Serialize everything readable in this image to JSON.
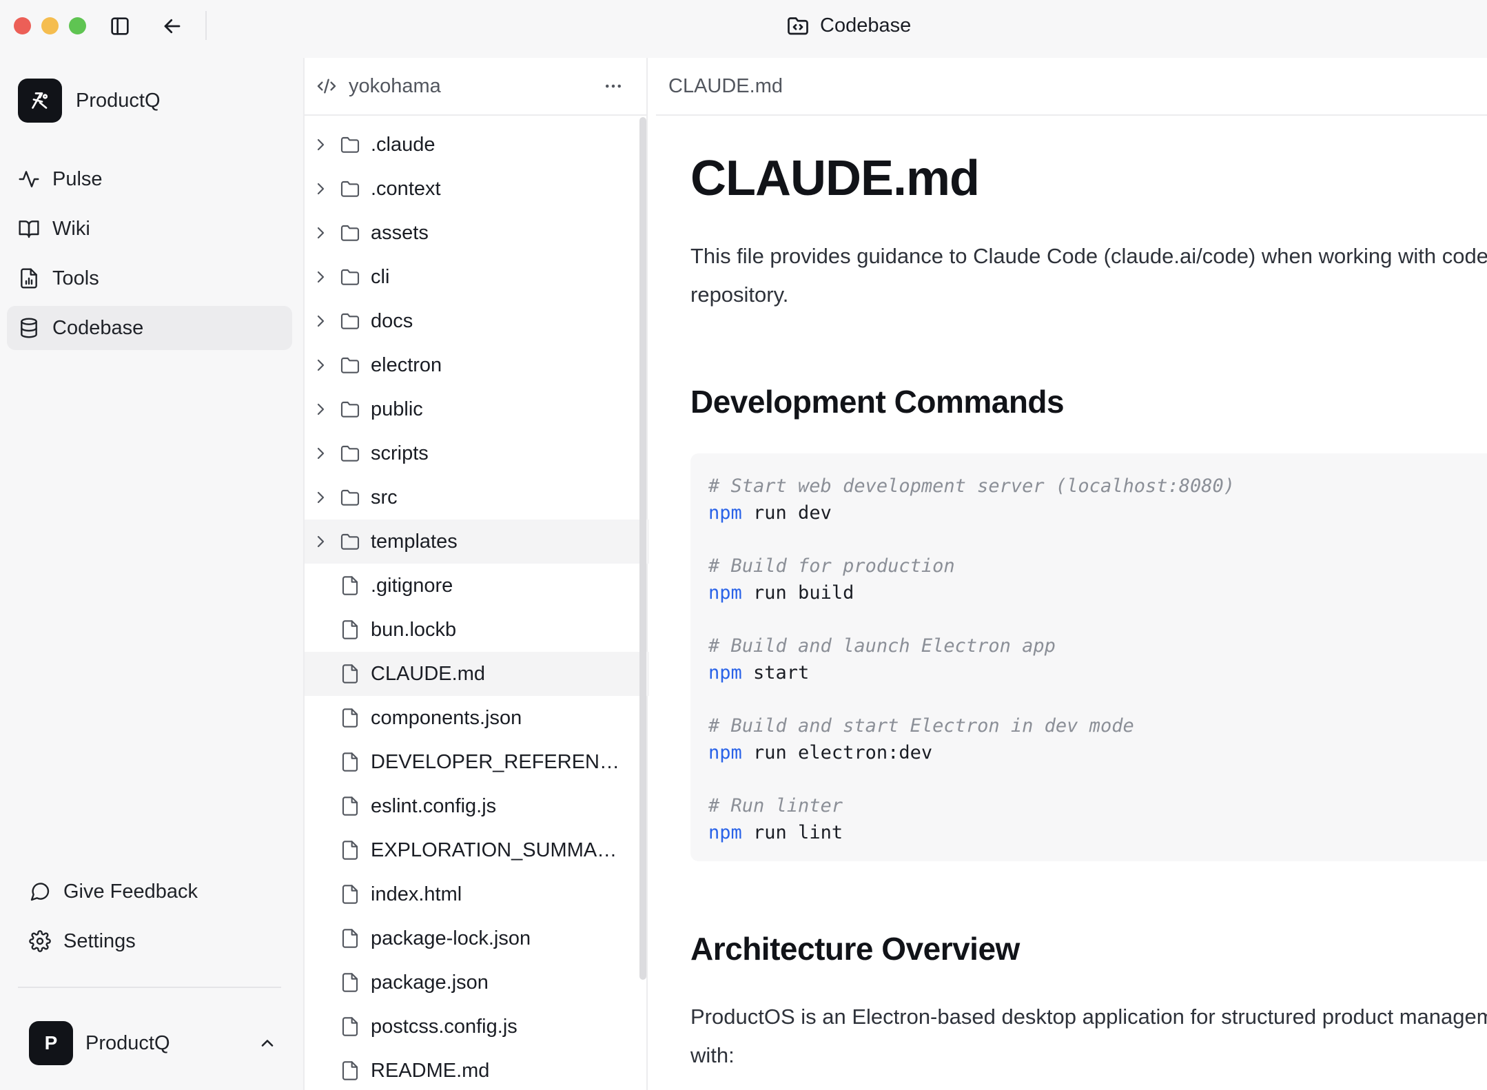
{
  "window": {
    "title": "Codebase"
  },
  "sidebar": {
    "workspace_name": "ProductQ",
    "nav": [
      {
        "label": "Pulse",
        "icon": "activity-icon"
      },
      {
        "label": "Wiki",
        "icon": "book-icon"
      },
      {
        "label": "Tools",
        "icon": "file-chart-icon"
      },
      {
        "label": "Codebase",
        "icon": "database-icon",
        "active": true
      }
    ],
    "bottom": [
      {
        "label": "Give Feedback",
        "icon": "message-circle-icon"
      },
      {
        "label": "Settings",
        "icon": "gear-icon"
      }
    ],
    "user": {
      "initial": "P",
      "name": "ProductQ"
    }
  },
  "tree": {
    "repo": "yokohama",
    "items": [
      {
        "name": ".claude",
        "type": "folder"
      },
      {
        "name": ".context",
        "type": "folder"
      },
      {
        "name": "assets",
        "type": "folder"
      },
      {
        "name": "cli",
        "type": "folder"
      },
      {
        "name": "docs",
        "type": "folder"
      },
      {
        "name": "electron",
        "type": "folder"
      },
      {
        "name": "public",
        "type": "folder"
      },
      {
        "name": "scripts",
        "type": "folder"
      },
      {
        "name": "src",
        "type": "folder"
      },
      {
        "name": "templates",
        "type": "folder",
        "hover": true
      },
      {
        "name": ".gitignore",
        "type": "file"
      },
      {
        "name": "bun.lockb",
        "type": "file"
      },
      {
        "name": "CLAUDE.md",
        "type": "file",
        "selected": true
      },
      {
        "name": "components.json",
        "type": "file"
      },
      {
        "name": "DEVELOPER_REFERENCE...",
        "type": "file"
      },
      {
        "name": "eslint.config.js",
        "type": "file"
      },
      {
        "name": "EXPLORATION_SUMMAR...",
        "type": "file"
      },
      {
        "name": "index.html",
        "type": "file"
      },
      {
        "name": "package-lock.json",
        "type": "file"
      },
      {
        "name": "package.json",
        "type": "file"
      },
      {
        "name": "postcss.config.js",
        "type": "file"
      },
      {
        "name": "README.md",
        "type": "file"
      }
    ]
  },
  "doc": {
    "tab": "CLAUDE.md",
    "title": "CLAUDE.md",
    "intro": "This file provides guidance to Claude Code (claude.ai/code) when working with code in this repository.",
    "section1": "Development Commands",
    "code": [
      {
        "comment": "# Start web development server (localhost:8080)",
        "cmd": "npm",
        "args": " run dev"
      },
      {
        "comment": "# Build for production",
        "cmd": "npm",
        "args": " run build"
      },
      {
        "comment": "# Build and launch Electron app",
        "cmd": "npm",
        "args": " start"
      },
      {
        "comment": "# Build and start Electron in dev mode",
        "cmd": "npm",
        "args": " run electron:dev"
      },
      {
        "comment": "# Run linter",
        "cmd": "npm",
        "args": " run lint"
      }
    ],
    "section2": "Architecture Overview",
    "arch_intro": "ProductOS is an Electron-based desktop application for structured product management built with:"
  },
  "colors": {
    "accent": "#2a63e8",
    "comment": "#8b8f97",
    "sidebar_bg": "#f7f7f8"
  }
}
